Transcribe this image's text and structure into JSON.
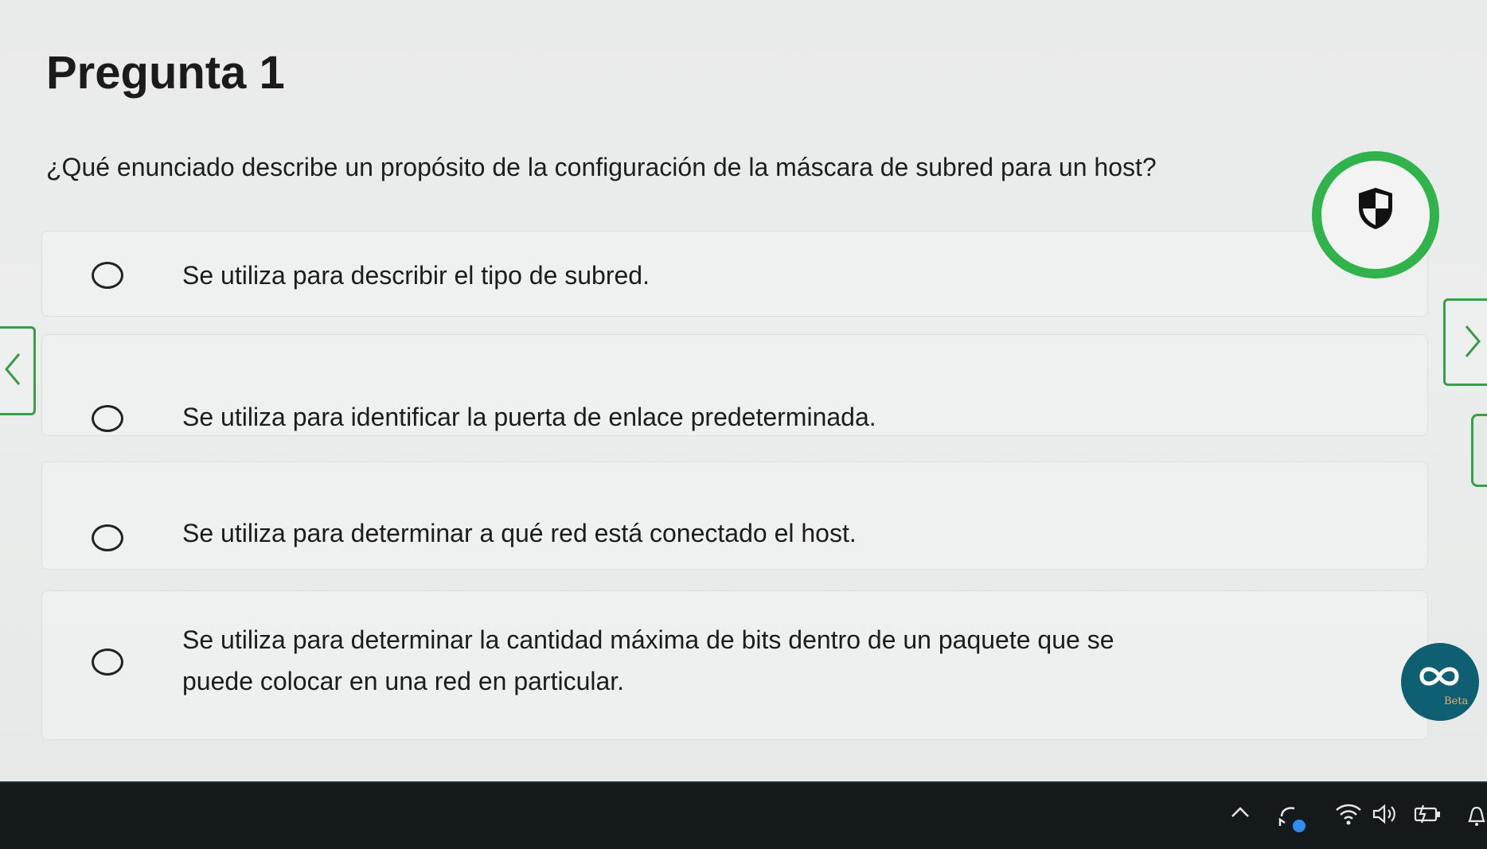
{
  "page": {
    "title": "Pregunta 1",
    "question": "¿Qué enunciado describe un propósito de la configuración de la máscara de subred para un host?"
  },
  "options": [
    {
      "text": "Se utiliza para describir el tipo de subred.",
      "selected": false
    },
    {
      "text": "Se utiliza para identificar la puerta de enlace predeterminada.",
      "selected": false
    },
    {
      "text": "Se utiliza para determinar a qué red está conectado el host.",
      "selected": false
    },
    {
      "line1": "Se utiliza para determinar la cantidad máxima de bits dentro de un paquete que se",
      "line2": "puede colocar en una red en particular.",
      "selected": false
    }
  ],
  "widgets": {
    "beta_label": "Beta",
    "shield_icon": "shield-icon",
    "accent_color": "#2fb34a"
  },
  "taskbar": {
    "icons": [
      "chevron-up-icon",
      "sync-icon",
      "wifi-icon",
      "volume-icon",
      "battery-icon",
      "notification-icon"
    ]
  }
}
